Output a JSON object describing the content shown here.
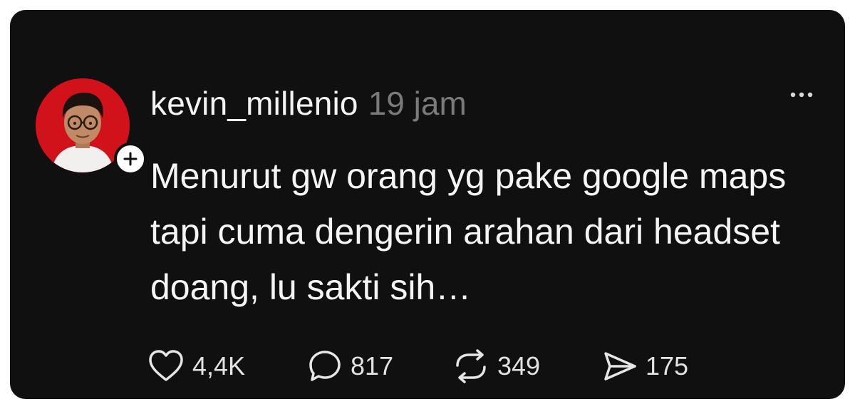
{
  "post": {
    "username": "kevin_millenio",
    "timestamp": "19 jam",
    "text": "Menurut gw orang yg pake google maps tapi cuma dengerin arahan dari headset doang, lu sakti sih…",
    "avatar_bg_color": "#d2121b",
    "follow_icon": "plus-icon",
    "more_icon": "more-horizontal-icon"
  },
  "actions": {
    "like": {
      "icon": "heart-icon",
      "count": "4,4K"
    },
    "reply": {
      "icon": "comment-icon",
      "count": "817"
    },
    "repost": {
      "icon": "repost-icon",
      "count": "349"
    },
    "share": {
      "icon": "send-icon",
      "count": "175"
    }
  },
  "colors": {
    "background": "#101010",
    "text_primary": "#f5f5f5",
    "text_secondary": "#7a7a7a"
  }
}
